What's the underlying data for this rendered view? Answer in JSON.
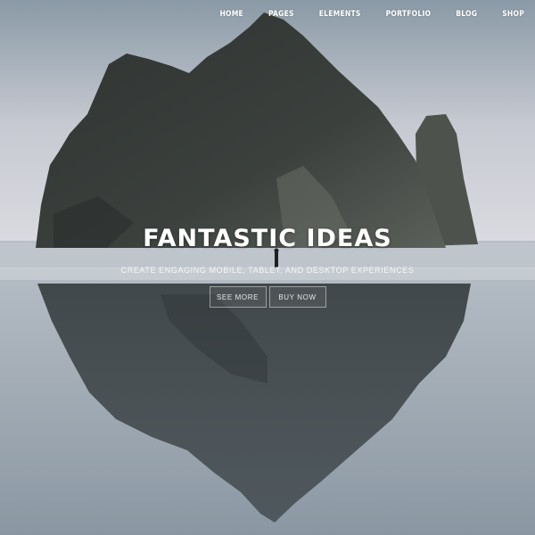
{
  "nav": {
    "items": [
      {
        "label": "HOME"
      },
      {
        "label": "PAGES"
      },
      {
        "label": "ELEMENTS"
      },
      {
        "label": "PORTFOLIO"
      },
      {
        "label": "BLOG"
      },
      {
        "label": "SHOP"
      }
    ]
  },
  "hero": {
    "title": "FANTASTIC IDEAS",
    "subtitle": "CREATE ENGAGING MOBILE, TABLET, AND DESKTOP EXPERIENCES",
    "buttons": {
      "see_more": "SEE MORE",
      "buy_now": "BUY NOW"
    }
  },
  "colors": {
    "sky": "#c9ccd2",
    "rock": "#3a3e3c",
    "water": "#9aa6ae",
    "text": "#ffffff"
  }
}
